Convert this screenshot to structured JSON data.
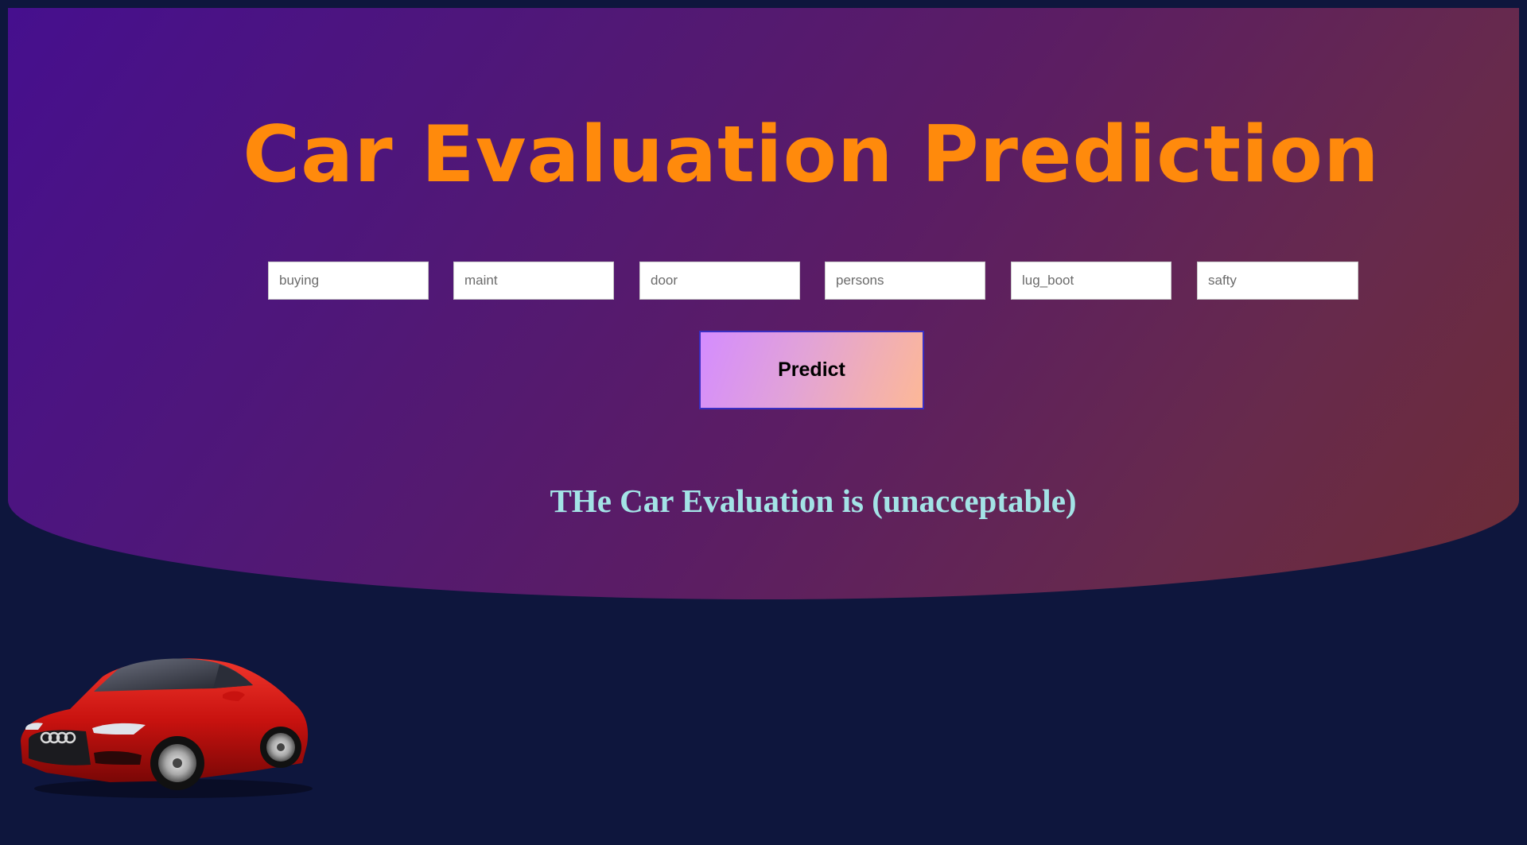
{
  "title": "Car Evaluation Prediction",
  "inputs": {
    "buying": "buying",
    "maint": "maint",
    "door": "door",
    "persons": "persons",
    "lug_boot": "lug_boot",
    "safety": "safty"
  },
  "predict_button": "Predict",
  "result_text": "THe Car Evaluation is (unacceptable)",
  "colors": {
    "page_background": "#0e163d",
    "gradient_start": "#460f8e",
    "gradient_end": "#6e2c36",
    "title": "#ff8a0c",
    "result": "#a3e3e6",
    "button_start": "#d48cff",
    "button_end": "#fdb897",
    "button_border": "#3a2ec2"
  },
  "images": {
    "car": "red-sports-car-image"
  }
}
